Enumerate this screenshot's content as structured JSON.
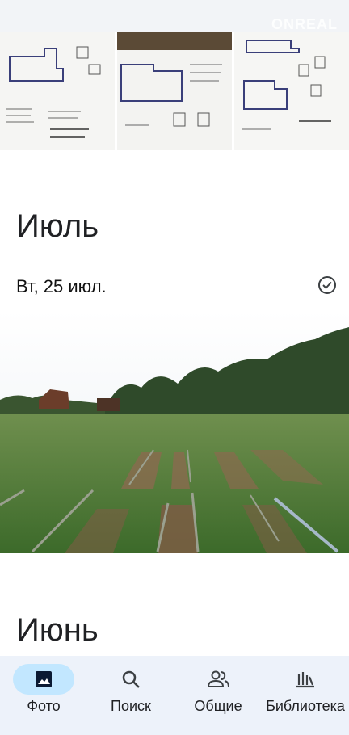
{
  "watermark": "ONREAL",
  "sections": [
    {
      "month": "Июль",
      "day_label": "Вт, 25 июл."
    },
    {
      "month": "Июнь"
    }
  ],
  "bottom_nav": {
    "items": [
      {
        "label": "Фото",
        "icon": "photo-icon",
        "active": true
      },
      {
        "label": "Поиск",
        "icon": "search-icon",
        "active": false
      },
      {
        "label": "Общие",
        "icon": "people-icon",
        "active": false
      },
      {
        "label": "Библиотека",
        "icon": "library-icon",
        "active": false
      }
    ]
  },
  "colors": {
    "nav_bg": "#edf2fa",
    "active_pill": "#c2e7ff",
    "text": "#202124"
  }
}
